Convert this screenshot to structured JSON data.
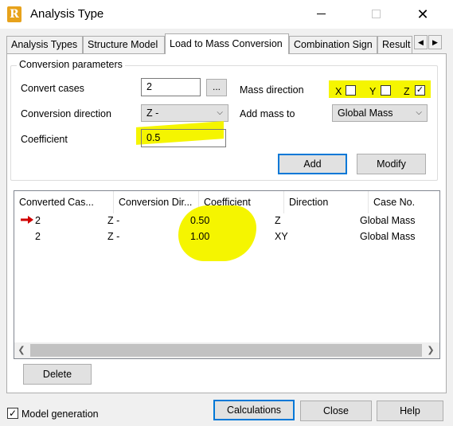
{
  "window": {
    "title": "Analysis Type",
    "icon_letter": "R",
    "minimize_label": "",
    "maximize_label": "",
    "close_label": "✕"
  },
  "tabs": [
    {
      "label": "Analysis Types",
      "active": false
    },
    {
      "label": "Structure Model",
      "active": false
    },
    {
      "label": "Load to Mass Conversion",
      "active": true
    },
    {
      "label": "Combination Sign",
      "active": false
    },
    {
      "label": "Result",
      "active": false
    }
  ],
  "tab_scroll": {
    "left": "◀",
    "right": "▶"
  },
  "conversion": {
    "group_title": "Conversion parameters",
    "convert_cases_label": "Convert cases",
    "convert_cases_value": "2",
    "browse_label": "...",
    "conversion_direction_label": "Conversion direction",
    "conversion_direction_value": "Z -",
    "coefficient_label": "Coefficient",
    "coefficient_value": "0.5",
    "mass_direction_label": "Mass direction",
    "mass_direction": [
      {
        "axis": "X",
        "checked": false
      },
      {
        "axis": "Y",
        "checked": false
      },
      {
        "axis": "Z",
        "checked": true
      }
    ],
    "add_mass_to_label": "Add mass to",
    "add_mass_to_value": "Global Mass",
    "add_button": "Add",
    "modify_button": "Modify"
  },
  "table": {
    "columns": [
      "Converted Cas...",
      "Conversion Dir...",
      "Coefficient",
      "Direction",
      "Case No."
    ],
    "rows": [
      {
        "cases": "2",
        "direction_conv": "Z -",
        "coefficient": "0.50",
        "direction": "Z",
        "case_no": "Global Mass",
        "current": true
      },
      {
        "cases": "2",
        "direction_conv": "Z -",
        "coefficient": "1.00",
        "direction": "XY",
        "case_no": "Global Mass",
        "current": false
      }
    ]
  },
  "delete_button": "Delete",
  "footer": {
    "model_generation_label": "Model generation",
    "model_generation_checked": true,
    "calculations_button": "Calculations",
    "close_button": "Close",
    "help_button": "Help"
  },
  "colors": {
    "highlight": "#f5f500",
    "accent": "#0078d7",
    "arrow": "#d00000"
  }
}
